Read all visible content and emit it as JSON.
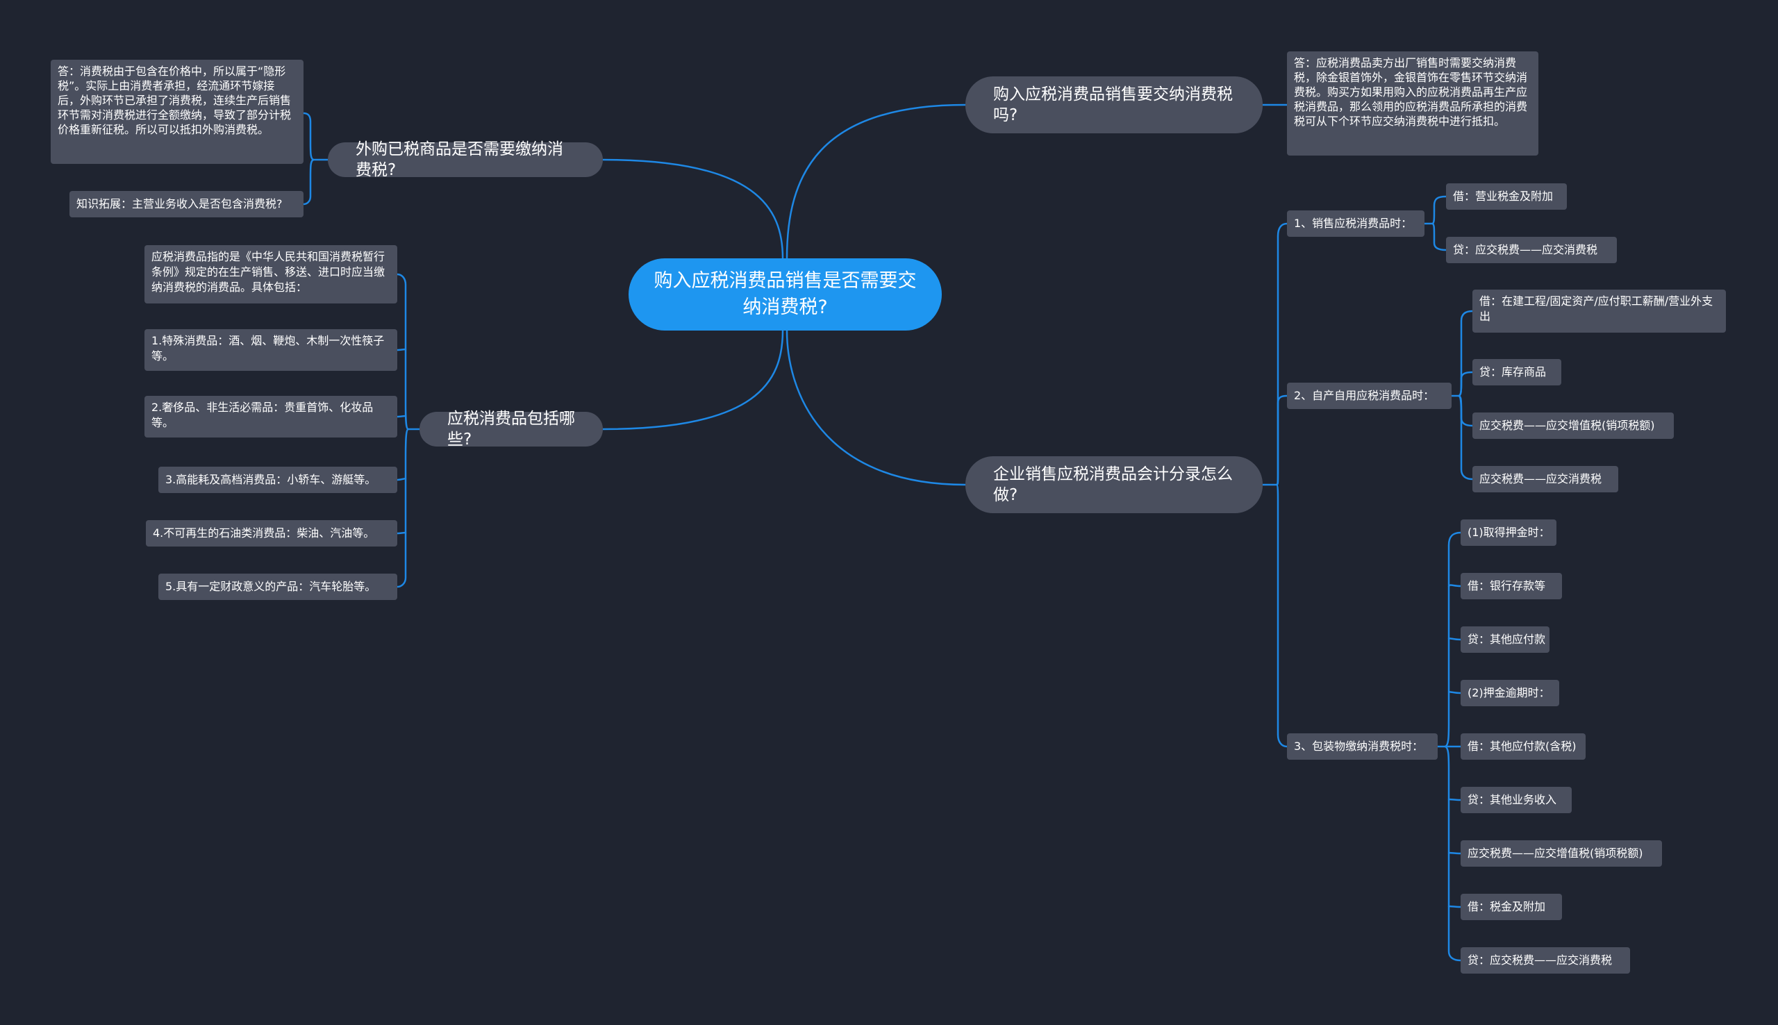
{
  "root": {
    "text": "购入应税消费品销售是否需要交纳消费税?"
  },
  "topics": {
    "q_pay": "购入应税消费品销售要交纳消费税吗?",
    "q_accounting": "企业销售应税消费品会计分录怎么做?",
    "q_outsourced": "外购已税商品是否需要缴纳消费税?",
    "q_include": "应税消费品包括哪些?"
  },
  "answers": {
    "q_pay": "答：应税消费品卖方出厂销售时需要交纳消费税，除金银首饰外，金银首饰在零售环节交纳消费税。购买方如果用购入的应税消费品再生产应税消费品，那么领用的应税消费品所承担的消费税可从下个环节应交纳消费税中进行抵扣。",
    "q_outsourced": "答：消费税由于包含在价格中，所以属于“隐形税”。实际上由消费者承担，经流通环节嫁接后，外购环节已承担了消费税，连续生产后销售环节需对消费税进行全额缴纳，导致了部分计税价格重新征税。所以可以抵扣外购消费税。",
    "q_outsourced_extra": "知识拓展：主营业务收入是否包含消费税?"
  },
  "accounting": {
    "sale": {
      "label": "1、销售应税消费品时：",
      "items": [
        "借：营业税金及附加",
        "贷：应交税费——应交消费税"
      ]
    },
    "self_use": {
      "label": "2、自产自用应税消费品时：",
      "items": [
        "借：在建工程/固定资产/应付职工薪酬/营业外支出",
        "贷：库存商品",
        "应交税费——应交增值税(销项税额)",
        "应交税费——应交消费税"
      ]
    },
    "packaging": {
      "label": "3、包装物缴纳消费税时：",
      "items": [
        "(1)取得押金时：",
        "借：银行存款等",
        "贷：其他应付款",
        "(2)押金逾期时：",
        "借：其他应付款(含税)",
        "贷：其他业务收入",
        "应交税费——应交增值税(销项税额)",
        "借：税金及附加",
        "贷：应交税费——应交消费税"
      ]
    }
  },
  "includes": {
    "intro": "应税消费品指的是《中华人民共和国消费税暂行条例》规定的在生产销售、移送、进口时应当缴纳消费税的消费品。具体包括：",
    "items": [
      "1.特殊消费品：酒、烟、鞭炮、木制一次性筷子等。",
      "2.奢侈品、非生活必需品：贵重首饰、化妆品等。",
      "3.高能耗及高档消费品：小轿车、游艇等。",
      "4.不可再生的石油类消费品：柴油、汽油等。",
      "5.具有一定财政意义的产品：汽车轮胎等。"
    ]
  },
  "colors": {
    "background": "#1f2430",
    "node": "#4a4f5e",
    "root": "#1e96f0",
    "link": "#1e88e5"
  }
}
